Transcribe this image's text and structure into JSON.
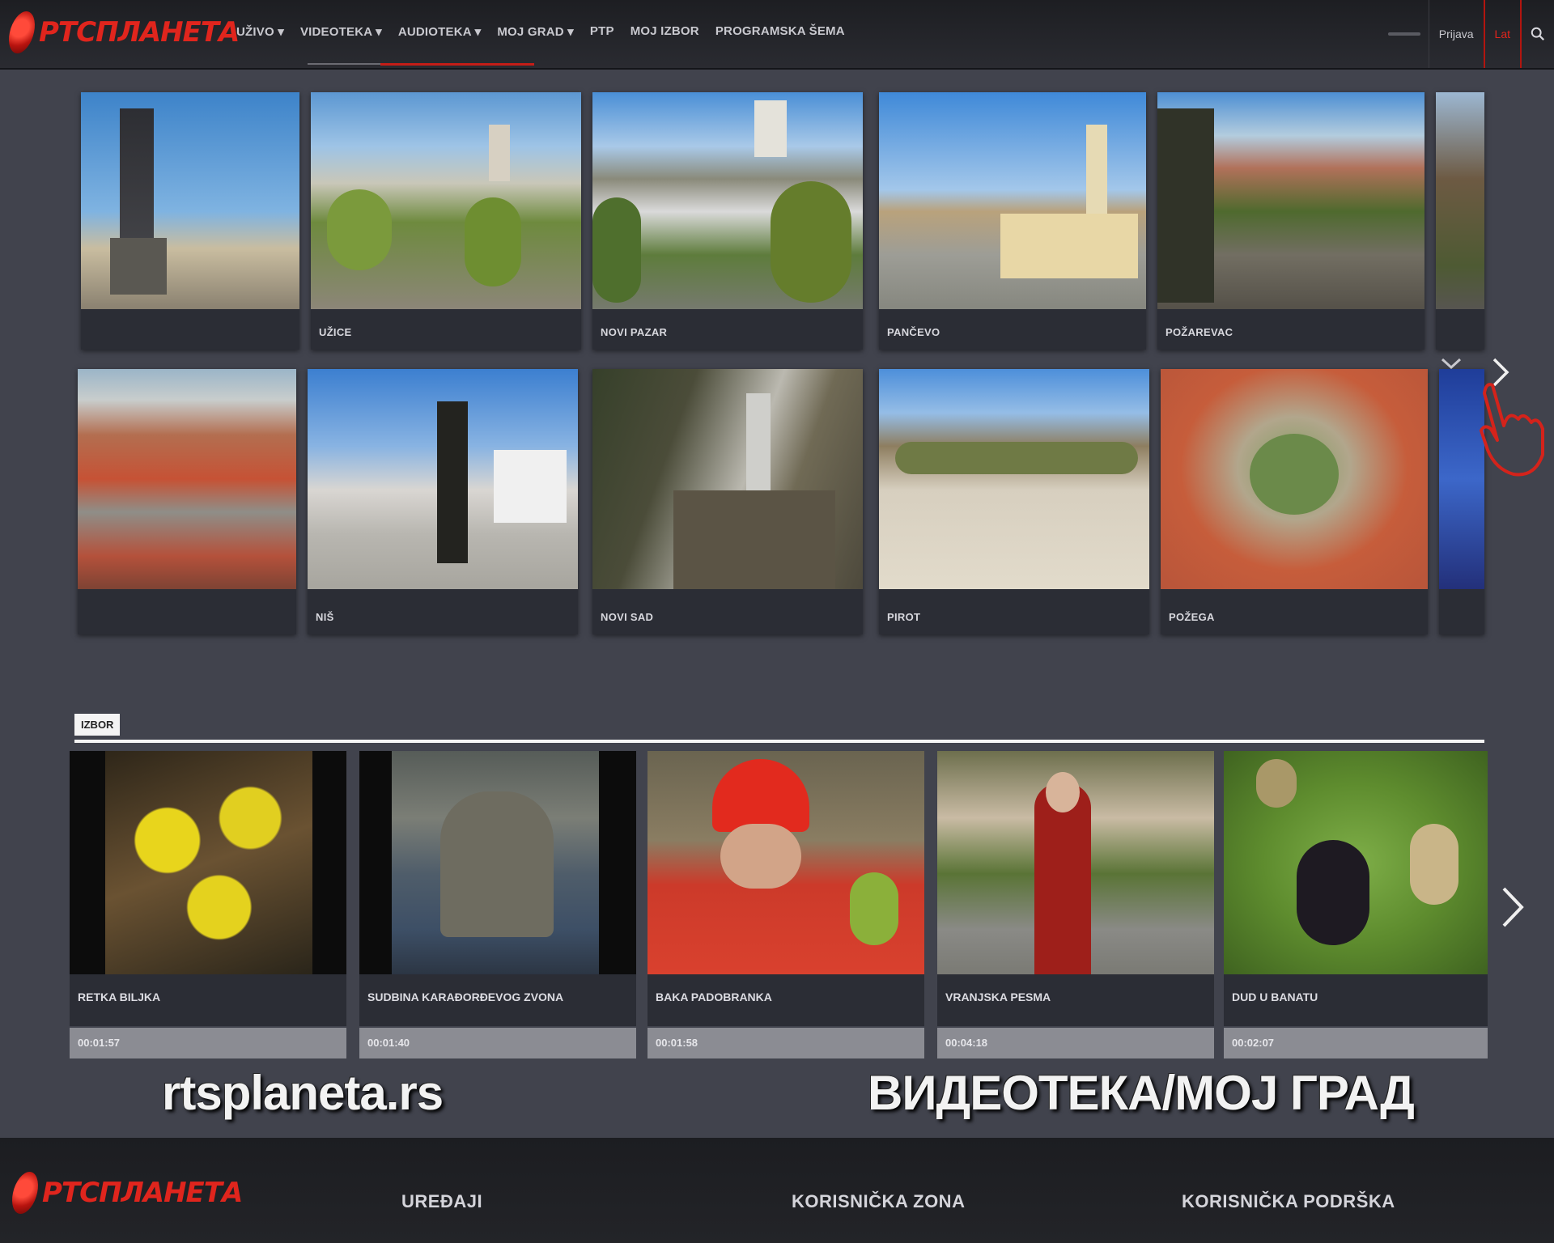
{
  "brand": {
    "logo_text": "РТСПЛАНЕТА",
    "accent": "#e0251d"
  },
  "nav": {
    "items": [
      {
        "label": "UŽIVO",
        "caret": "▾"
      },
      {
        "label": "VIDEOTEKA",
        "caret": "▾"
      },
      {
        "label": "AUDIOTEKA",
        "caret": "▾"
      },
      {
        "label": "MOJ GRAD",
        "caret": "▾"
      },
      {
        "label": "PTP",
        "caret": ""
      },
      {
        "label": "MOJ IZBOR",
        "caret": ""
      },
      {
        "label": "PROGRAMSKA ŠEMA",
        "caret": ""
      }
    ]
  },
  "topright": {
    "login": "Prijava",
    "lang": "Lat",
    "icon": "search-icon"
  },
  "cities": {
    "row1": [
      {
        "name": "",
        "scene": "monument"
      },
      {
        "name": "UŽICE",
        "scene": "city-hill"
      },
      {
        "name": "NOVI PAZAR",
        "scene": "city-mountain"
      },
      {
        "name": "PANČEVO",
        "scene": "square-clock"
      },
      {
        "name": "POŽAREVAC",
        "scene": "aerial-park"
      },
      {
        "name": "",
        "scene": "partial"
      }
    ],
    "row2": [
      {
        "name": "",
        "scene": "roofs"
      },
      {
        "name": "NIŠ",
        "scene": "monument-square"
      },
      {
        "name": "NOVI SAD",
        "scene": "fortress"
      },
      {
        "name": "PIROT",
        "scene": "plaza"
      },
      {
        "name": "POŽEGA",
        "scene": "aerial-roofs"
      },
      {
        "name": "",
        "scene": "partial-blue"
      }
    ]
  },
  "izbor": {
    "label": "IZBOR",
    "items": [
      {
        "title": "RETKA BILJKA",
        "duration": "00:01:57",
        "scene": "flowers"
      },
      {
        "title": "SUDBINA KARAĐORĐEVOG ZVONA",
        "duration": "00:01:40",
        "scene": "bell"
      },
      {
        "title": "BAKA PADOBRANKA",
        "duration": "00:01:58",
        "scene": "grandma"
      },
      {
        "title": "VRANJSKA PESMA",
        "duration": "00:04:18",
        "scene": "singer"
      },
      {
        "title": "DUD U BANATU",
        "duration": "00:02:07",
        "scene": "mulberry"
      }
    ]
  },
  "overlay": {
    "left": "rtsplaneta.rs",
    "right": "ВИДЕОТЕКА/МОЈ ГРАД"
  },
  "footer": {
    "links": [
      "UREĐAJI",
      "KORISNIČKA ZONA",
      "KORISNIČKA PODRŠKA"
    ]
  }
}
